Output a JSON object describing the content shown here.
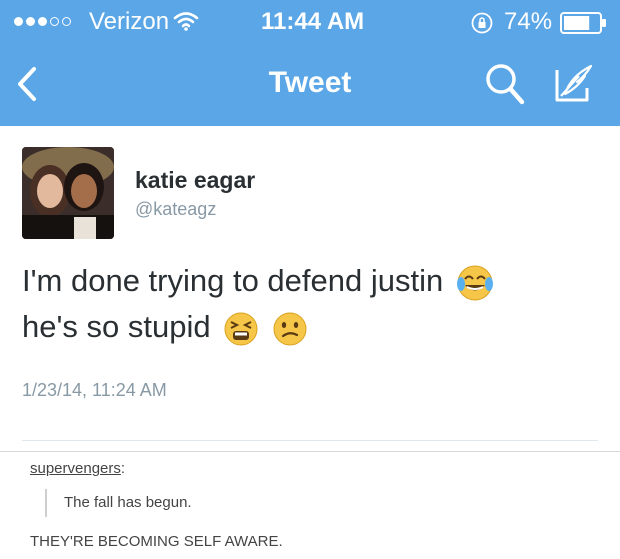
{
  "status_bar": {
    "carrier": "Verizon",
    "signal_bars_filled": 3,
    "signal_bars_total": 5,
    "time": "11:44 AM",
    "battery_percent": "74%",
    "battery_level": 0.74
  },
  "nav": {
    "title": "Tweet",
    "back_icon": "chevron-left-icon",
    "search_icon": "search-icon",
    "compose_icon": "compose-icon"
  },
  "tweet": {
    "author_name": "katie eagar",
    "author_handle": "@kateagz",
    "text_line_1": "I'm done trying to defend justin",
    "text_line_2": "he's so stupid",
    "emojis": [
      "face-with-tears-of-joy",
      "tired-face",
      "confused-face"
    ],
    "timestamp": "1/23/14, 11:24 AM"
  },
  "tumblr": {
    "username": "supervengers",
    "username_suffix": ":",
    "quote": "The fall has begun.",
    "reply": "THEY'RE BECOMING SELF AWARE."
  },
  "colors": {
    "header_blue": "#5aa6e6",
    "text_dark": "#292f33",
    "text_gray": "#8899a6"
  }
}
